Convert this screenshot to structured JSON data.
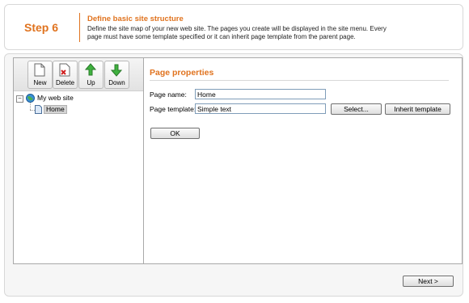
{
  "header": {
    "step": "Step 6",
    "title": "Define basic site structure",
    "description": "Define the site map of your new web site. The pages you create will be displayed in the site menu. Every page must have some template specified or it can inherit page template from the parent page."
  },
  "toolbar": {
    "new": "New",
    "delete": "Delete",
    "up": "Up",
    "down": "Down"
  },
  "tree": {
    "root": "My web site",
    "child": "Home"
  },
  "properties": {
    "title": "Page properties",
    "page_name_label": "Page name:",
    "page_name_value": "Home",
    "page_template_label": "Page template:",
    "page_template_value": "Simple text",
    "select_button": "Select...",
    "inherit_button": "Inherit template",
    "ok_button": "OK"
  },
  "footer": {
    "next_button": "Next >"
  },
  "colors": {
    "accent": "#e0731f",
    "input_border": "#7f9db9"
  }
}
